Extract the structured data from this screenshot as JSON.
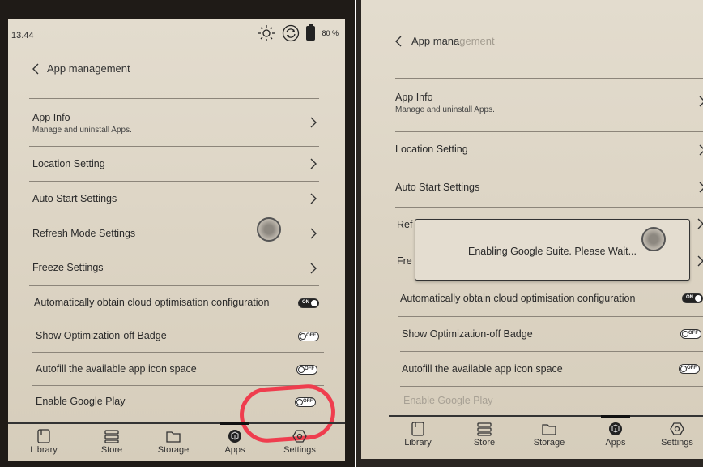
{
  "left_screen": {
    "status": {
      "time": "13.44",
      "battery": "80 %"
    },
    "title": "App management",
    "items": [
      {
        "label": "App Info",
        "sub": "Manage and uninstall Apps."
      },
      {
        "label": "Location Setting"
      },
      {
        "label": "Auto Start Settings"
      },
      {
        "label": "Refresh Mode Settings"
      },
      {
        "label": "Freeze Settings"
      },
      {
        "label": "Automatically obtain cloud optimisation configuration",
        "toggle": "ON"
      },
      {
        "label": "Show Optimization-off Badge",
        "toggle": "OFF"
      },
      {
        "label": "Autofill the available app icon space",
        "toggle": "OFF"
      },
      {
        "label": "Enable Google Play",
        "toggle": "OFF"
      }
    ],
    "nav": [
      "Library",
      "Store",
      "Storage",
      "Apps",
      "Settings"
    ]
  },
  "right_screen": {
    "title_part1": "App mana",
    "title_part2": "gement",
    "items": [
      {
        "label": "App Info",
        "sub": "Manage and uninstall Apps."
      },
      {
        "label": "Location Setting"
      },
      {
        "label": "Auto Start Settings"
      },
      {
        "label": "Ref"
      },
      {
        "label": "Fre"
      },
      {
        "label": "Automatically obtain cloud optimisation configuration",
        "toggle": "ON"
      },
      {
        "label": "Show Optimization-off Badge",
        "toggle": "OFF"
      },
      {
        "label": "Autofill the available app icon space",
        "toggle": "OFF"
      },
      {
        "label": "Enable Google Play"
      }
    ],
    "dialog": "Enabling Google Suite. Please Wait...",
    "nav": [
      "Library",
      "Store",
      "Storage",
      "Apps",
      "Settings"
    ]
  },
  "colors": {
    "annotation": "#ef3d4e",
    "screen": "#ddd5c5",
    "ink": "#222222"
  },
  "icons": [
    "sun-icon",
    "sync-icon",
    "battery-icon",
    "chevron-left-icon",
    "chevron-right-icon",
    "library-icon",
    "store-icon",
    "storage-icon",
    "apps-icon",
    "settings-icon"
  ]
}
